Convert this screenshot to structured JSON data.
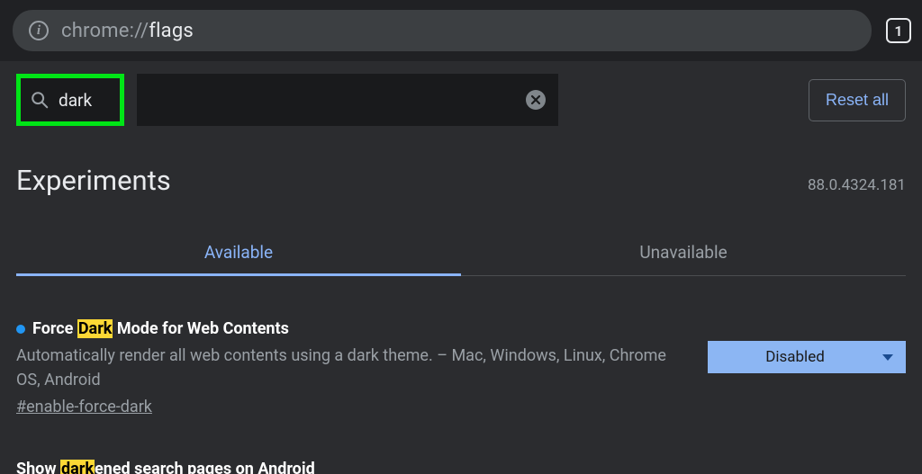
{
  "omnibox": {
    "scheme": "chrome://",
    "path": "flags"
  },
  "tab_count": "1",
  "search": {
    "value": "dark"
  },
  "reset_label": "Reset all",
  "page_title": "Experiments",
  "version": "88.0.4324.181",
  "tabs": {
    "available": "Available",
    "unavailable": "Unavailable"
  },
  "flags": [
    {
      "title_pre": "Force ",
      "title_hl": "Dark",
      "title_post": " Mode for Web Contents",
      "desc": "Automatically render all web contents using a dark theme. – Mac, Windows, Linux, Chrome OS, Android",
      "anchor": "#enable-force-dark",
      "value": "Disabled"
    },
    {
      "title_pre": "Show ",
      "title_hl": "dark",
      "title_post": "ened search pages on Android"
    }
  ]
}
